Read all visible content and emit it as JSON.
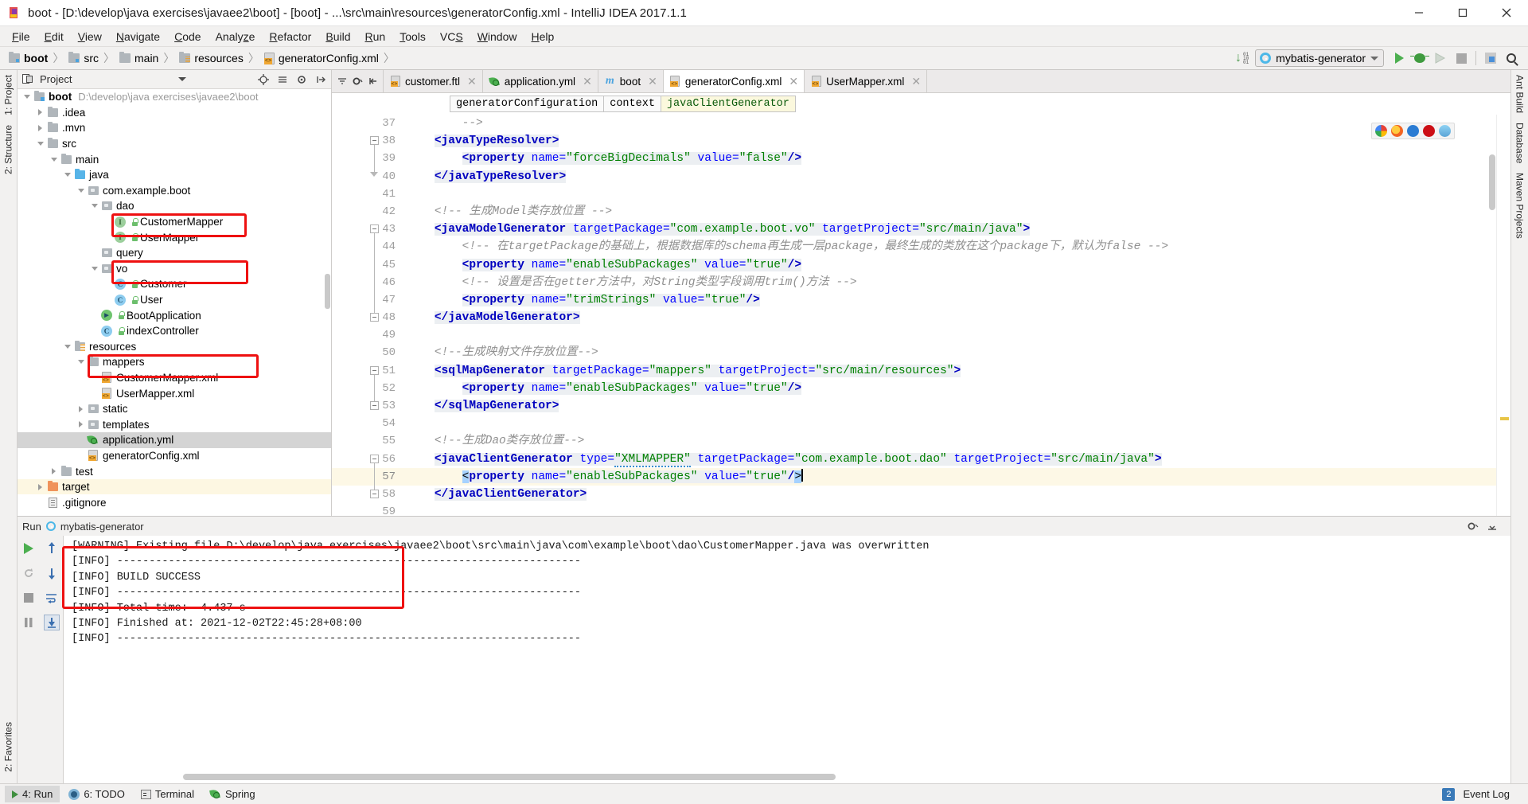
{
  "window": {
    "title": "boot - [D:\\develop\\java exercises\\javaee2\\boot] - [boot] - ...\\src\\main\\resources\\generatorConfig.xml - IntelliJ IDEA 2017.1.1",
    "minimize": "–",
    "maximize": "❐",
    "close": "✕"
  },
  "menu": [
    "File",
    "Edit",
    "View",
    "Navigate",
    "Code",
    "Analyze",
    "Refactor",
    "Build",
    "Run",
    "Tools",
    "VCS",
    "Window",
    "Help"
  ],
  "navbar": {
    "crumbs": [
      "boot",
      "src",
      "main",
      "resources",
      "generatorConfig.xml"
    ],
    "run_config": "mybatis-generator",
    "buttons": [
      "run-button",
      "debug-button",
      "run-with-coverage-button",
      "stop-button",
      "toggle-bookmarks-button",
      "search-everywhere-button"
    ]
  },
  "left_rail": [
    "1: Project",
    "2: Structure",
    "2: Favorites"
  ],
  "right_rail": [
    "Ant Build",
    "Database",
    "Maven Projects"
  ],
  "project": {
    "title": "Project",
    "tree": [
      {
        "indent": 0,
        "twist": "down",
        "icon": "module",
        "label": "boot",
        "path": "D:\\develop\\java exercises\\javaee2\\boot",
        "bold": true,
        "state": "normal"
      },
      {
        "indent": 1,
        "twist": "right",
        "icon": "folder",
        "label": ".idea",
        "path": "",
        "bold": false,
        "state": "normal"
      },
      {
        "indent": 1,
        "twist": "right",
        "icon": "folder",
        "label": ".mvn",
        "path": "",
        "bold": false,
        "state": "normal"
      },
      {
        "indent": 1,
        "twist": "down",
        "icon": "folder",
        "label": "src",
        "path": "",
        "bold": false,
        "state": "normal"
      },
      {
        "indent": 2,
        "twist": "down",
        "icon": "folder",
        "label": "main",
        "path": "",
        "bold": false,
        "state": "normal"
      },
      {
        "indent": 3,
        "twist": "down",
        "icon": "folder-blue",
        "label": "java",
        "path": "",
        "bold": false,
        "state": "normal"
      },
      {
        "indent": 4,
        "twist": "down",
        "icon": "package",
        "label": "com.example.boot",
        "path": "",
        "bold": false,
        "state": "normal"
      },
      {
        "indent": 5,
        "twist": "down",
        "icon": "package",
        "label": "dao",
        "path": "",
        "bold": false,
        "state": "normal"
      },
      {
        "indent": 6,
        "twist": "none",
        "icon": "interface",
        "label": "CustomerMapper",
        "path": "",
        "bold": false,
        "state": "normal"
      },
      {
        "indent": 6,
        "twist": "none",
        "icon": "interface",
        "label": "UserMapper",
        "path": "",
        "bold": false,
        "state": "normal"
      },
      {
        "indent": 5,
        "twist": "none",
        "icon": "package",
        "label": "query",
        "path": "",
        "bold": false,
        "state": "normal"
      },
      {
        "indent": 5,
        "twist": "down",
        "icon": "package",
        "label": "vo",
        "path": "",
        "bold": false,
        "state": "normal"
      },
      {
        "indent": 6,
        "twist": "none",
        "icon": "class",
        "label": "Customer",
        "path": "",
        "bold": false,
        "state": "normal"
      },
      {
        "indent": 6,
        "twist": "none",
        "icon": "class",
        "label": "User",
        "path": "",
        "bold": false,
        "state": "normal"
      },
      {
        "indent": 5,
        "twist": "none",
        "icon": "spring-class",
        "label": "BootApplication",
        "path": "",
        "bold": false,
        "state": "normal"
      },
      {
        "indent": 5,
        "twist": "none",
        "icon": "class",
        "label": "indexController",
        "path": "",
        "bold": false,
        "state": "normal"
      },
      {
        "indent": 3,
        "twist": "down",
        "icon": "folder-res",
        "label": "resources",
        "path": "",
        "bold": false,
        "state": "normal"
      },
      {
        "indent": 4,
        "twist": "down",
        "icon": "folder",
        "label": "mappers",
        "path": "",
        "bold": false,
        "state": "normal"
      },
      {
        "indent": 5,
        "twist": "none",
        "icon": "xml",
        "label": "CustomerMapper.xml",
        "path": "",
        "bold": false,
        "state": "normal"
      },
      {
        "indent": 5,
        "twist": "none",
        "icon": "xml",
        "label": "UserMapper.xml",
        "path": "",
        "bold": false,
        "state": "normal"
      },
      {
        "indent": 4,
        "twist": "right",
        "icon": "package",
        "label": "static",
        "path": "",
        "bold": false,
        "state": "normal"
      },
      {
        "indent": 4,
        "twist": "right",
        "icon": "package",
        "label": "templates",
        "path": "",
        "bold": false,
        "state": "normal"
      },
      {
        "indent": 4,
        "twist": "none",
        "icon": "spring-yml",
        "label": "application.yml",
        "path": "",
        "bold": false,
        "state": "selected"
      },
      {
        "indent": 4,
        "twist": "none",
        "icon": "xml",
        "label": "generatorConfig.xml",
        "path": "",
        "bold": false,
        "state": "normal"
      },
      {
        "indent": 2,
        "twist": "right",
        "icon": "folder",
        "label": "test",
        "path": "",
        "bold": false,
        "state": "normal"
      },
      {
        "indent": 1,
        "twist": "right",
        "icon": "folder-orange",
        "label": "target",
        "path": "",
        "bold": false,
        "state": "highlight"
      },
      {
        "indent": 1,
        "twist": "none",
        "icon": "text",
        "label": ".gitignore",
        "path": "",
        "bold": false,
        "state": "normal"
      }
    ]
  },
  "editor": {
    "tabs": [
      {
        "label": "customer.ftl",
        "icon": "ftl-icon",
        "active": false
      },
      {
        "label": "application.yml",
        "icon": "spring-yml-icon",
        "active": false
      },
      {
        "label": "boot",
        "icon": "maven-icon",
        "active": false
      },
      {
        "label": "generatorConfig.xml",
        "icon": "xml-icon",
        "active": true
      },
      {
        "label": "UserMapper.xml",
        "icon": "xml-icon",
        "active": false
      }
    ],
    "breadcrumbs": [
      {
        "label": "generatorConfiguration",
        "highlight": false
      },
      {
        "label": "context",
        "highlight": false
      },
      {
        "label": "javaClientGenerator",
        "highlight": true
      }
    ],
    "first_line_number": 37,
    "current_line": 57,
    "lines": [
      {
        "n": 37,
        "html": "        <span class='k-cmt'>--&gt;</span>"
      },
      {
        "n": 38,
        "html": "    <span class='hlbg'><span class='k-tag'>&lt;javaTypeResolver&gt;</span></span>"
      },
      {
        "n": 39,
        "html": "        <span class='hlbg'><span class='k-tag'>&lt;property </span><span class='k-attr'>name=</span><span class='k-val'>\"forceBigDecimals\"</span><span class='k-attr'> value=</span><span class='k-val'>\"false\"</span><span class='k-tag'>/&gt;</span></span>"
      },
      {
        "n": 40,
        "html": "    <span class='hlbg'><span class='k-tag'>&lt;/javaTypeResolver&gt;</span></span>"
      },
      {
        "n": 41,
        "html": ""
      },
      {
        "n": 42,
        "html": "    <span class='k-cmt'>&lt;!-- 生成Model类存放位置 --&gt;</span>"
      },
      {
        "n": 43,
        "html": "    <span class='hlbg'><span class='k-tag'>&lt;javaModelGenerator </span><span class='k-attr'>targetPackage=</span><span class='k-val'>\"com.example.boot.vo\"</span><span class='k-attr'> targetProject=</span><span class='k-val'>\"src/main/java\"</span><span class='k-tag'>&gt;</span></span>"
      },
      {
        "n": 44,
        "html": "        <span class='k-cmt'>&lt;!-- 在targetPackage的基础上，根据数据库的schema再生成一层package，最终生成的类放在这个package下，默认为false --&gt;</span>"
      },
      {
        "n": 45,
        "html": "        <span class='hlbg'><span class='k-tag'>&lt;property </span><span class='k-attr'>name=</span><span class='k-val'>\"enableSubPackages\"</span><span class='k-attr'> value=</span><span class='k-val'>\"true\"</span><span class='k-tag'>/&gt;</span></span>"
      },
      {
        "n": 46,
        "html": "        <span class='k-cmt'>&lt;!-- 设置是否在getter方法中，对String类型字段调用trim()方法 --&gt;</span>"
      },
      {
        "n": 47,
        "html": "        <span class='hlbg'><span class='k-tag'>&lt;property </span><span class='k-attr'>name=</span><span class='k-val'>\"trimStrings\"</span><span class='k-attr'> value=</span><span class='k-val'>\"true\"</span><span class='k-tag'>/&gt;</span></span>"
      },
      {
        "n": 48,
        "html": "    <span class='hlbg'><span class='k-tag'>&lt;/javaModelGenerator&gt;</span></span>"
      },
      {
        "n": 49,
        "html": ""
      },
      {
        "n": 50,
        "html": "    <span class='k-cmt'>&lt;!--生成映射文件存放位置--&gt;</span>"
      },
      {
        "n": 51,
        "html": "    <span class='hlbg'><span class='k-tag'>&lt;sqlMapGenerator </span><span class='k-attr'>targetPackage=</span><span class='k-val'>\"mappers\"</span><span class='k-attr'> targetProject=</span><span class='k-val'>\"src/main/resources\"</span><span class='k-tag'>&gt;</span></span>"
      },
      {
        "n": 52,
        "html": "        <span class='hlbg'><span class='k-tag'>&lt;property </span><span class='k-attr'>name=</span><span class='k-val'>\"enableSubPackages\"</span><span class='k-attr'> value=</span><span class='k-val'>\"true\"</span><span class='k-tag'>/&gt;</span></span>"
      },
      {
        "n": 53,
        "html": "    <span class='hlbg'><span class='k-tag'>&lt;/sqlMapGenerator&gt;</span></span>"
      },
      {
        "n": 54,
        "html": ""
      },
      {
        "n": 55,
        "html": "    <span class='k-cmt'>&lt;!--生成Dao类存放位置--&gt;</span>"
      },
      {
        "n": 56,
        "html": "    <span class='hlbg'><span class='k-tag'>&lt;javaClientGenerator </span><span class='k-attr'>type=</span><span class='k-val squig'>\"XMLMAPPER\"</span><span class='k-attr'> targetPackage=</span><span class='k-val'>\"com.example.boot.dao\"</span><span class='k-attr'> targetProject=</span><span class='k-val'>\"src/main/java\"</span><span class='k-tag'>&gt;</span></span>"
      },
      {
        "n": 57,
        "html": "        <span class='selblue'>&lt;</span><span class='hlbg'><span class='k-tag'>property </span><span class='k-attr'>name=</span><span class='k-val'>\"enableSubPackages\"</span><span class='k-attr'> value=</span><span class='k-val'>\"true\"</span><span class='k-tag'>/</span></span><span class='selblue'>&gt;</span><span class='caret'></span>"
      },
      {
        "n": 58,
        "html": "    <span class='hlbg'><span class='k-tag'>&lt;/javaClientGenerator&gt;</span></span>"
      },
      {
        "n": 59,
        "html": ""
      }
    ]
  },
  "run": {
    "tool_label": "Run",
    "config_name": "mybatis-generator",
    "console_lines": [
      "[WARNING] Existing file D:\\develop\\java exercises\\javaee2\\boot\\src\\main\\java\\com\\example\\boot\\dao\\CustomerMapper.java was overwritten",
      "[INFO] ------------------------------------------------------------------------",
      "[INFO] BUILD SUCCESS",
      "[INFO] ------------------------------------------------------------------------",
      "[INFO] Total time:  4.437 s",
      "[INFO] Finished at: 2021-12-02T22:45:28+08:00",
      "[INFO] ------------------------------------------------------------------------"
    ],
    "tool_buttons": [
      "rerun-button",
      "scroll-up-button",
      "stop-button",
      "scroll-down-button",
      "pause-button",
      "soft-wrap-button",
      "print-button",
      "scroll-to-end-button"
    ]
  },
  "statusbar": {
    "items": [
      {
        "label": "4: Run",
        "icon": "run-icon",
        "active": true
      },
      {
        "label": "6: TODO",
        "icon": "todo-icon",
        "active": false
      },
      {
        "label": "Terminal",
        "icon": "terminal-icon",
        "active": false
      },
      {
        "label": "Spring",
        "icon": "spring-icon",
        "active": false
      }
    ],
    "event_log": "Event Log",
    "event_count": "2"
  },
  "colors": {
    "accent_blue": "#4aa3df",
    "success_green": "#4caf50",
    "annotation_red": "#ee1111",
    "tag_blue": "#0000c0",
    "value_green": "#008000",
    "comment_gray": "#909090",
    "selection_blue": "#a6d2ff",
    "current_line_yellow": "#fdf8e6"
  }
}
